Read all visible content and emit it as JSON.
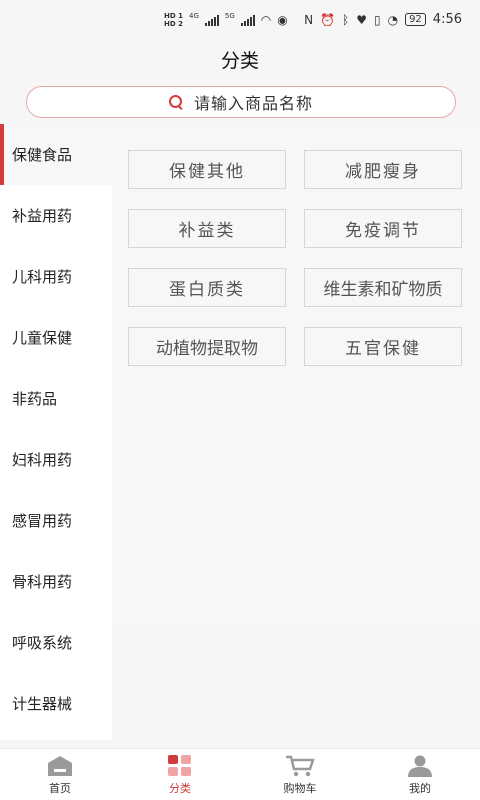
{
  "status_bar": {
    "hd1": "HD 1",
    "hd2": "HD 2",
    "net1": "4G",
    "net2": "5G",
    "battery": "92",
    "time": "4:56"
  },
  "header": {
    "title": "分类"
  },
  "search": {
    "placeholder": "请输入商品名称"
  },
  "sidebar": {
    "items": [
      {
        "label": "保健食品"
      },
      {
        "label": "补益用药"
      },
      {
        "label": "儿科用药"
      },
      {
        "label": "儿童保健"
      },
      {
        "label": "非药品"
      },
      {
        "label": "妇科用药"
      },
      {
        "label": "感冒用药"
      },
      {
        "label": "骨科用药"
      },
      {
        "label": "呼吸系统"
      },
      {
        "label": "计生器械"
      }
    ]
  },
  "subcategories": [
    {
      "label": "保健其他"
    },
    {
      "label": "减肥瘦身"
    },
    {
      "label": "补益类"
    },
    {
      "label": "免疫调节"
    },
    {
      "label": "蛋白质类"
    },
    {
      "label": "维生素和矿物质"
    },
    {
      "label": "动植物提取物"
    },
    {
      "label": "五官保健"
    }
  ],
  "bottom_nav": {
    "items": [
      {
        "label": "首页"
      },
      {
        "label": "分类"
      },
      {
        "label": "购物车"
      },
      {
        "label": "我的"
      }
    ]
  },
  "colors": {
    "accent": "#d33c3c",
    "inactive_icon": "#9a9a9a",
    "active_icon_light": "#f0a4a4"
  }
}
